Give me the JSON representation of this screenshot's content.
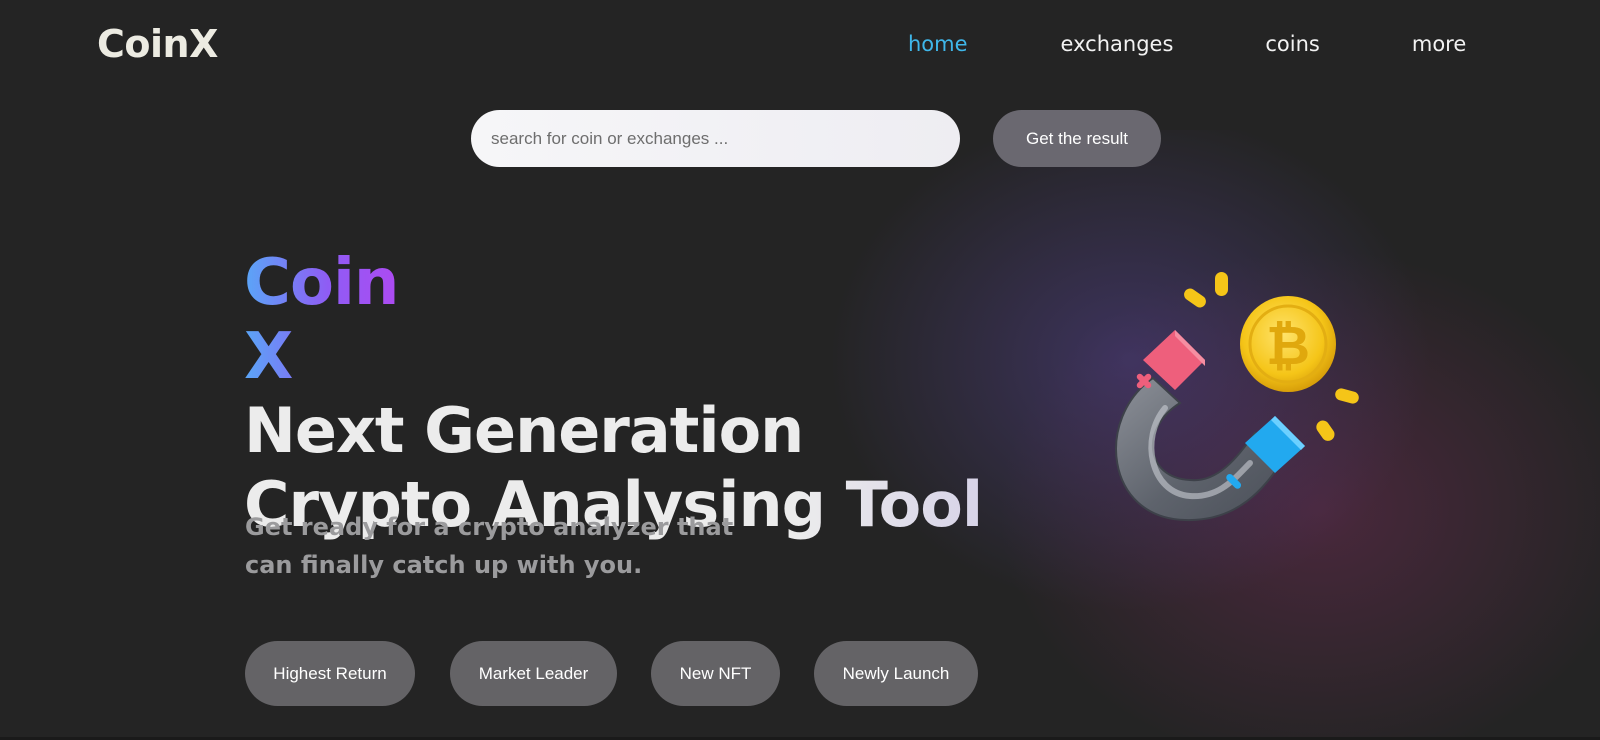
{
  "header": {
    "logo": "CoinX",
    "nav": [
      {
        "label": "home",
        "active": true
      },
      {
        "label": "exchanges",
        "active": false
      },
      {
        "label": "coins",
        "active": false
      },
      {
        "label": "more",
        "active": false
      }
    ]
  },
  "search": {
    "placeholder": "search for coin or exchanges ...",
    "value": "",
    "button_label": "Get the result"
  },
  "hero": {
    "brand": "Coin X",
    "title_line1": "Next Generation",
    "title_line2": "Crypto Analysing Tool",
    "subtitle": "Get ready for a crypto analyzer that can finally catch up with you."
  },
  "chips": [
    {
      "label": "Highest Return"
    },
    {
      "label": "Market Leader"
    },
    {
      "label": "New NFT"
    },
    {
      "label": "Newly Launch"
    }
  ],
  "illustration": {
    "icon": "magnet-attracting-bitcoin-icon",
    "coin_icon": "bitcoin-coin-icon"
  },
  "colors": {
    "background": "#242424",
    "nav_active": "#3fb7ea",
    "brand_gradient_start": "#5aa6f7",
    "brand_gradient_end": "#c53cf0",
    "button_bg": "#6a6870",
    "chip_bg": "#646366"
  }
}
